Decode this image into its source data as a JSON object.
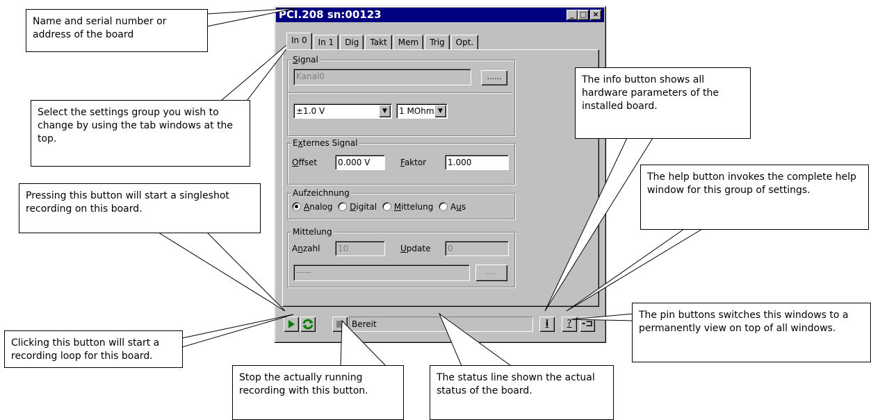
{
  "window": {
    "title": "PCI.208 sn:00123",
    "controls": {
      "minimize": "_",
      "maximize": "□",
      "close": "×"
    },
    "tabs": [
      "In 0",
      "In 1",
      "Dig",
      "Takt",
      "Mem",
      "Trig",
      "Opt."
    ],
    "active_tab": "In 0"
  },
  "signal": {
    "group_label_u": "S",
    "group_label_rest": "ignal",
    "channel_value": "Kanal0",
    "range_value": "±1.0 V",
    "impedance_value": "1 MOhm"
  },
  "external": {
    "group_label_pre": "E",
    "group_label_u": "x",
    "group_label_rest": "ternes Signal",
    "offset_label_u": "O",
    "offset_label_rest": "ffset",
    "offset_value": "0.000 V",
    "factor_label_u": "F",
    "factor_label_rest": "aktor",
    "factor_value": "1.000"
  },
  "recording": {
    "group_label": "Aufzeichnung",
    "options": [
      {
        "u": "A",
        "rest": "nalog",
        "selected": true
      },
      {
        "u": "D",
        "rest": "igital",
        "selected": false
      },
      {
        "u": "M",
        "rest": "ittelung",
        "selected": false
      },
      {
        "pre": "A",
        "u": "u",
        "rest": "s",
        "selected": false
      }
    ]
  },
  "averaging": {
    "group_label": "Mittelung",
    "count_label_pre": "A",
    "count_label_u": "n",
    "count_label_rest": "zahl",
    "count_value": "10",
    "update_label_u": "U",
    "update_label_rest": "pdate",
    "update_value": "0",
    "bottom_value": "-----"
  },
  "statusbar": {
    "status_text": "Bereit",
    "info_label": "i",
    "help_label": "?",
    "pin_label": "-⊐"
  },
  "icons": [
    "play-icon",
    "loop-icon",
    "stop-icon",
    "pin-icon"
  ],
  "callouts": {
    "name": "Name and serial number or address of the board",
    "tabs": "Select the settings group you wish to change by using the tab windows at the top.",
    "singleshot": "Pressing this button will start a singleshot recording on this board.",
    "loop": "Clicking this button will start a recording loop for this board.",
    "stop": "Stop the actually running recording with this button.",
    "status": "The status line shown the actual status of the board.",
    "info": "The info button shows all hardware parameters of the installed board.",
    "help": "The help button invokes the complete help window for this group of settings.",
    "pin": "The pin buttons switches this windows to a  permanently view on top of all windows."
  }
}
